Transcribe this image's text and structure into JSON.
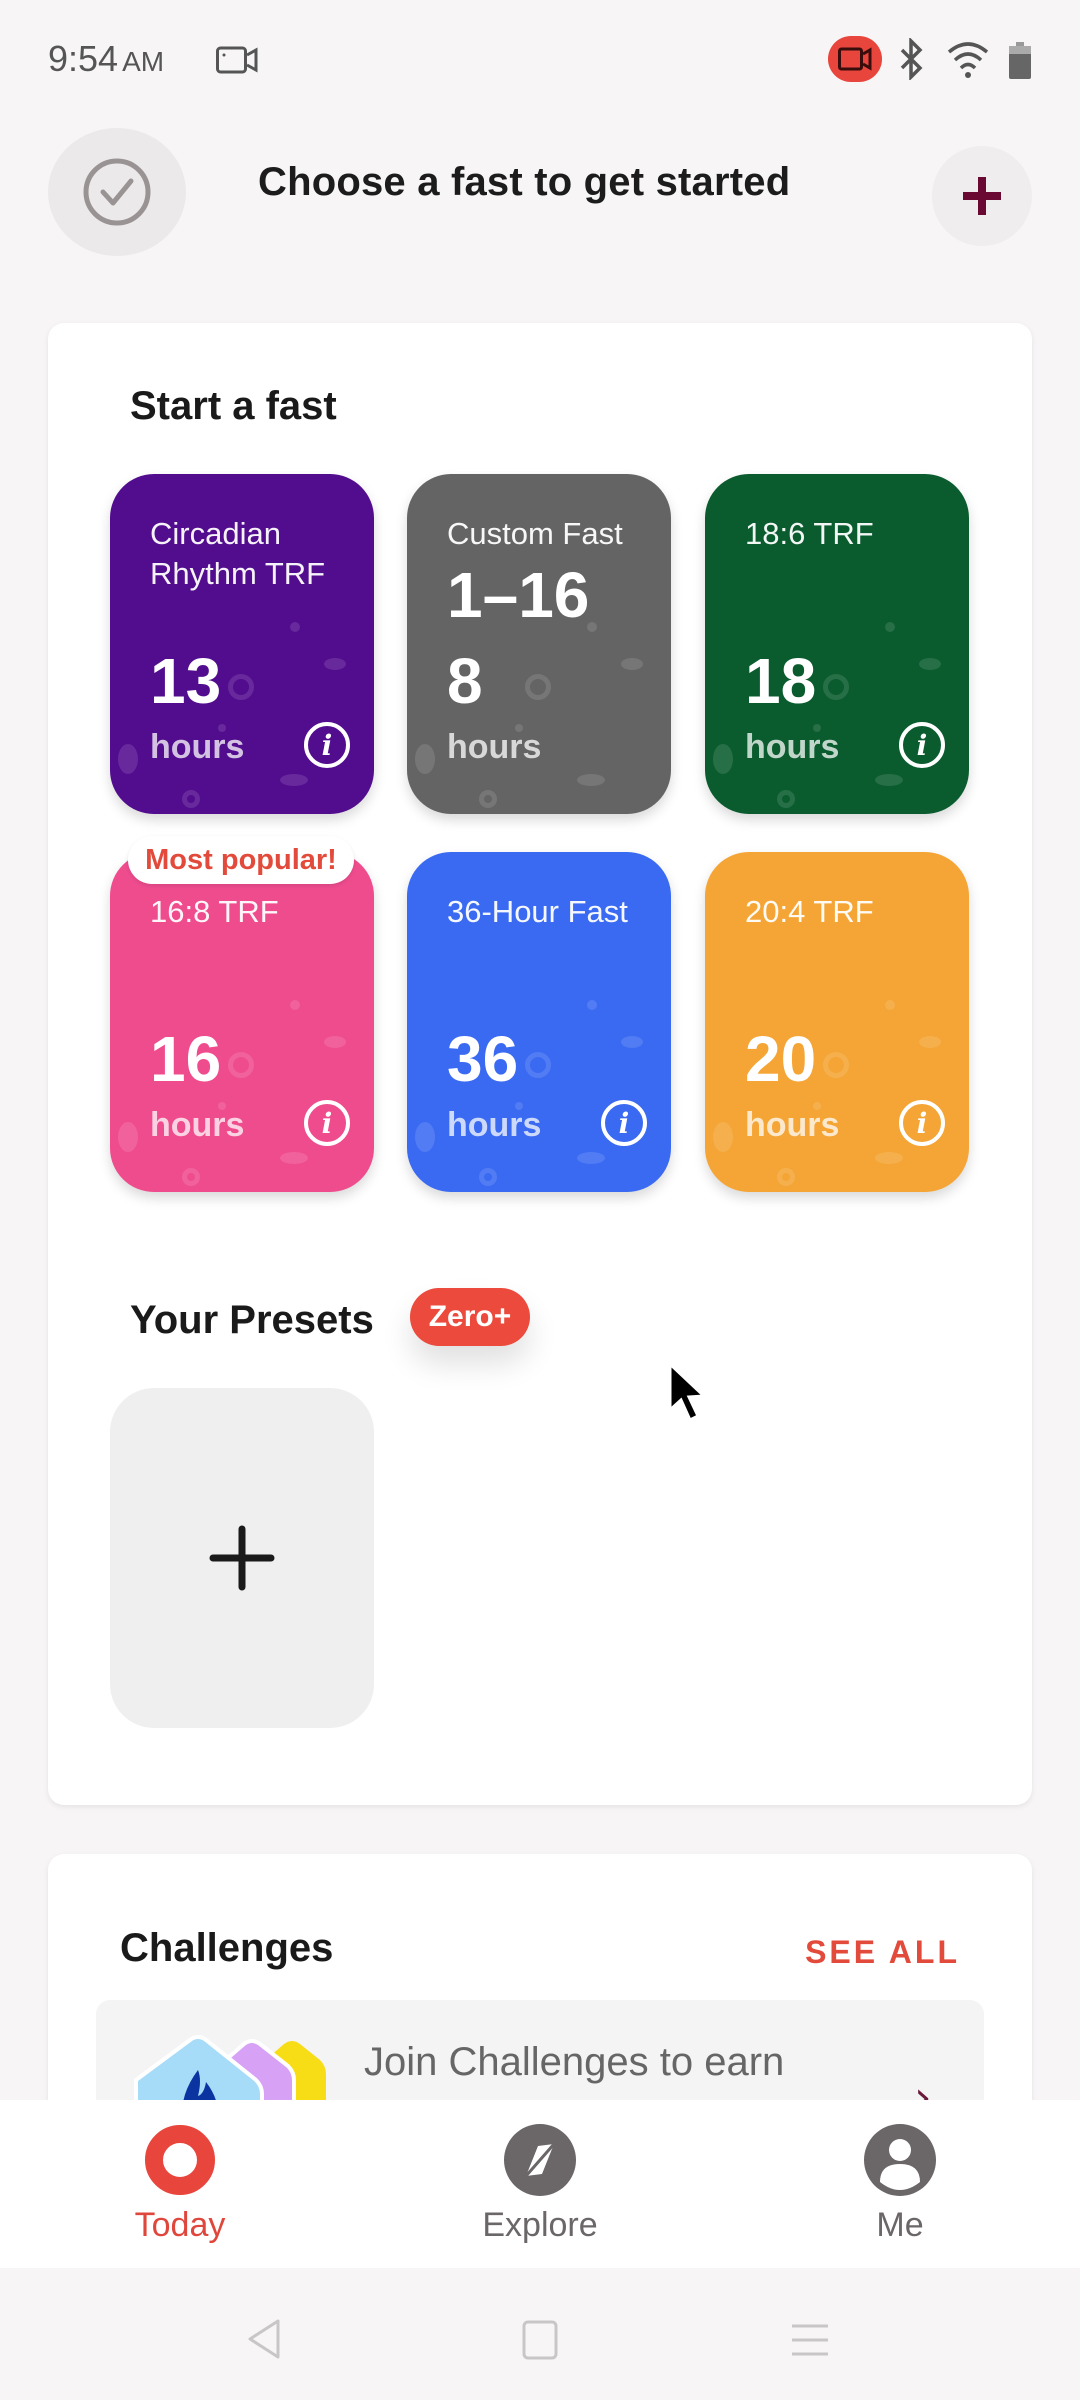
{
  "status_bar": {
    "time": "9:54",
    "ampm": "AM",
    "icons": [
      "screen-record-icon",
      "recording-indicator-icon",
      "bluetooth-icon",
      "wifi-icon",
      "battery-icon"
    ]
  },
  "header": {
    "title": "Choose a fast to get started",
    "left_icon": "check-circle-icon",
    "right_icon": "plus-icon"
  },
  "start_fast": {
    "title": "Start a fast",
    "cards": [
      {
        "name": "Circadian Rhythm TRF",
        "hours": "13",
        "unit": "hours",
        "color": "#520c8e",
        "info": true
      },
      {
        "name": "Custom Fast",
        "hours": "8",
        "overlay": "1–16",
        "unit": "hours",
        "color": "#646464",
        "info": false
      },
      {
        "name": "18:6 TRF",
        "hours": "18",
        "unit": "hours",
        "color": "#0a5c2e",
        "info": true
      },
      {
        "name": "16:8 TRF",
        "hours": "16",
        "unit": "hours",
        "color": "#ef4c8e",
        "info": true,
        "badge": "Most popular!"
      },
      {
        "name": "36-Hour Fast",
        "hours": "36",
        "unit": "hours",
        "color": "#3a6af2",
        "info": true
      },
      {
        "name": "20:4 TRF",
        "hours": "20",
        "unit": "hours",
        "color": "#f4a535",
        "info": true
      }
    ]
  },
  "presets": {
    "title": "Your Presets",
    "badge": "Zero+",
    "add_icon": "plus-icon"
  },
  "challenges": {
    "title": "Challenges",
    "see_all": "SEE ALL",
    "promo_text": "Join Challenges to earn"
  },
  "bottom_nav": {
    "items": [
      {
        "label": "Today",
        "active": true
      },
      {
        "label": "Explore",
        "active": false
      },
      {
        "label": "Me",
        "active": false
      }
    ],
    "active_color": "#e8453c",
    "inactive_color": "#6b6768"
  }
}
